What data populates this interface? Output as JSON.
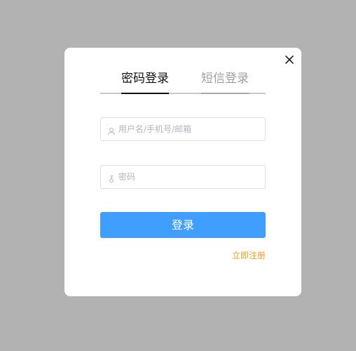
{
  "dialog": {
    "tabs": [
      {
        "label": "密码登录",
        "active": true
      },
      {
        "label": "短信登录",
        "active": false
      }
    ],
    "close_icon": "close-icon",
    "username_field": {
      "placeholder": "用户名/手机号/邮箱",
      "value": "",
      "icon": "user-icon"
    },
    "password_field": {
      "placeholder": "密码",
      "value": "",
      "icon": "key-icon"
    },
    "login_button_label": "登录",
    "register_link_label": "立即注册"
  },
  "colors": {
    "overlay": "#b2b2b2",
    "primary": "#409eff",
    "link": "#f0a020",
    "tab_active": "#111111",
    "tab_inactive": "#a0a0a0"
  }
}
